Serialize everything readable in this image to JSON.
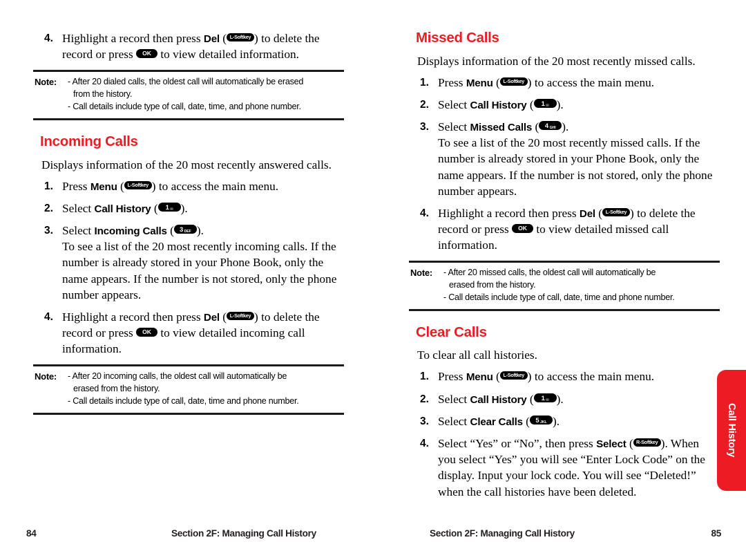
{
  "document": {
    "theme_red": "#ED1C24",
    "side_tab_label": "Call History"
  },
  "footer": {
    "left_page_number": "84",
    "left_section": "Section 2F: Managing Call History",
    "right_section": "Section 2F: Managing Call History",
    "right_page_number": "85"
  },
  "keys": {
    "left_softkey": "L-Softkey",
    "right_softkey": "R-Softkey",
    "ok": "OK",
    "key1_digit": "1",
    "key1_sub": "✉",
    "key3_digit": "3",
    "key3_sub": "DEF",
    "key4_digit": "4",
    "key4_sub": "GHI",
    "key5_digit": "5",
    "key5_sub": "JKL"
  },
  "left_column": {
    "dialed_calls_step4": {
      "number": "4.",
      "part1": "Highlight a record then press ",
      "bold1": "Del",
      "part2": " (",
      "part3": ") to delete the record or press ",
      "part4": " to view detailed information."
    },
    "dialed_note": {
      "label": "Note:",
      "line1": "- After 20 dialed calls, the oldest call will automatically be erased",
      "line1b": "from the history.",
      "line2": "- Call details include type of call, date, time, and phone number."
    },
    "incoming": {
      "heading": "Incoming Calls",
      "intro": "Displays information of the 20 most recently answered calls.",
      "step1": {
        "number": "1.",
        "part1": "Press ",
        "bold1": "Menu",
        "part2": " (",
        "part3": ") to access the main menu."
      },
      "step2": {
        "number": "2.",
        "part1": "Select ",
        "bold1": "Call History",
        "part2": " (",
        "part3": ")."
      },
      "step3": {
        "number": "3.",
        "part1": "Select ",
        "bold1": "Incoming Calls",
        "part2": " (",
        "part3": ").",
        "cont": "To see a list of the 20 most recently incoming calls. If the number is already stored in your Phone Book, only the name appears. If the number is not stored, only the phone number appears."
      },
      "step4": {
        "number": "4.",
        "part1": "Highlight a record then press ",
        "bold1": "Del",
        "part2": " (",
        "part3": ") to delete the record or press ",
        "part4": " to view detailed incoming call information."
      },
      "note": {
        "label": "Note:",
        "line1": "- After 20 incoming calls, the oldest call will automatically be",
        "line1b": "erased from the history.",
        "line2": "- Call details include type of call, date, time and phone number."
      }
    }
  },
  "right_column": {
    "missed": {
      "heading": "Missed Calls",
      "intro": "Displays information of the 20 most recently missed calls.",
      "step1": {
        "number": "1.",
        "part1": "Press ",
        "bold1": "Menu",
        "part2": " (",
        "part3": ") to access the main menu."
      },
      "step2": {
        "number": "2.",
        "part1": "Select ",
        "bold1": "Call History",
        "part2": " (",
        "part3": ")."
      },
      "step3": {
        "number": "3.",
        "part1": "Select ",
        "bold1": "Missed Calls",
        "part2": " (",
        "part3": ").",
        "cont": "To see a list of the 20 most recently missed calls. If the number is already stored in your Phone Book, only the name appears. If the number is not stored, only the phone number appears."
      },
      "step4": {
        "number": "4.",
        "part1": "Highlight a record then press ",
        "bold1": "Del",
        "part2": " (",
        "part3": ") to delete the record or press ",
        "part4": " to view detailed missed call information."
      },
      "note": {
        "label": "Note:",
        "line1": "- After 20 missed calls, the oldest call will automatically be",
        "line1b": "erased from the history.",
        "line2": "- Call details include type of call, date, time and phone number."
      }
    },
    "clear": {
      "heading": "Clear Calls",
      "intro": "To clear all call histories.",
      "step1": {
        "number": "1.",
        "part1": "Press ",
        "bold1": "Menu",
        "part2": " (",
        "part3": ") to access the main menu."
      },
      "step2": {
        "number": "2.",
        "part1": "Select ",
        "bold1": "Call History",
        "part2": " (",
        "part3": ")."
      },
      "step3": {
        "number": "3.",
        "part1": "Select ",
        "bold1": "Clear Calls",
        "part2": " (",
        "part3": ")."
      },
      "step4": {
        "number": "4.",
        "part1": "Select “Yes” or “No”, then press ",
        "bold1": "Select",
        "part2": " (",
        "part3": "). When you select “Yes” you will see “Enter Lock Code” on the display. Input your lock code. You will see “Deleted!” when the call histories have been deleted."
      }
    }
  }
}
